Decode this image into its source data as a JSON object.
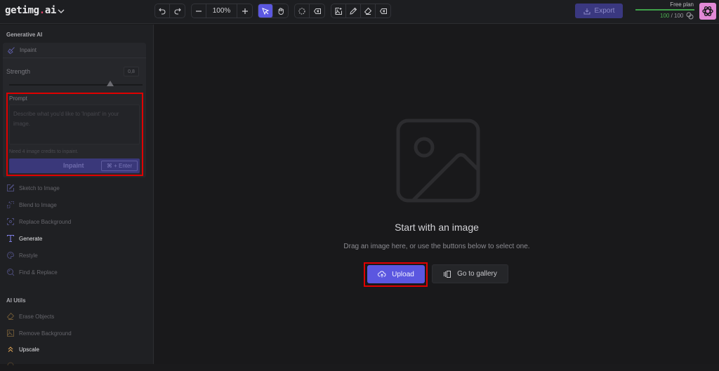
{
  "app": {
    "logo_main": "getimg",
    "logo_dot": ".",
    "logo_tld": "ai"
  },
  "toolbar": {
    "zoom_level": "100%",
    "tools": {
      "undo": "undo-icon",
      "redo": "redo-icon",
      "zoom_out": "minus-icon",
      "zoom_in": "plus-icon",
      "select": "cursor-icon",
      "pan": "hand-icon",
      "lasso": "lasso-icon",
      "clear_selection": "backspace-icon",
      "add_image": "image-plus-icon",
      "brush": "pencil-icon",
      "eraser": "eraser-icon",
      "clear_mask": "backspace-icon"
    },
    "active_tool": "select",
    "accent": "#5b57e0"
  },
  "header_right": {
    "export_label": "Export",
    "plan_label": "Free plan",
    "credits_used": "100",
    "credits_separator": " / ",
    "credits_total": "100",
    "credits_fraction": 1.0,
    "bar_color": "#3fa04a",
    "avatar_color": "#e28ad6"
  },
  "sidebar": {
    "section_generative": "Generative AI",
    "inpaint": {
      "title": "Inpaint",
      "strength_label": "Strength",
      "strength_value": "0,8",
      "strength_fraction": 0.8,
      "prompt_label": "Prompt",
      "prompt_placeholder": "Describe what you'd like to 'Inpaint' in your image.",
      "prompt_value": "",
      "credit_note": "Need 4 image credits to inpaint.",
      "button_label": "Inpaint",
      "shortcut": "⌘ + Enter"
    },
    "generative_items": [
      {
        "label": "Sketch to Image",
        "icon": "edit-square-icon",
        "active": false
      },
      {
        "label": "Blend to Image",
        "icon": "blend-icon",
        "active": false
      },
      {
        "label": "Replace Background",
        "icon": "focus-frame-icon",
        "active": false
      },
      {
        "label": "Generate",
        "icon": "text-t-icon",
        "active": true
      },
      {
        "label": "Restyle",
        "icon": "palette-icon",
        "active": false
      },
      {
        "label": "Find & Replace",
        "icon": "search-replace-icon",
        "active": false
      }
    ],
    "section_utils": "AI Utils",
    "util_items": [
      {
        "label": "Erase Objects",
        "icon": "eraser-icon",
        "active": false
      },
      {
        "label": "Remove Background",
        "icon": "image-remove-icon",
        "active": false
      },
      {
        "label": "Upscale",
        "icon": "chevrons-up-icon",
        "active": true
      }
    ]
  },
  "canvas": {
    "empty_title": "Start with an image",
    "empty_subtitle": "Drag an image here, or use the buttons below to select one.",
    "upload_label": "Upload",
    "gallery_label": "Go to gallery"
  }
}
